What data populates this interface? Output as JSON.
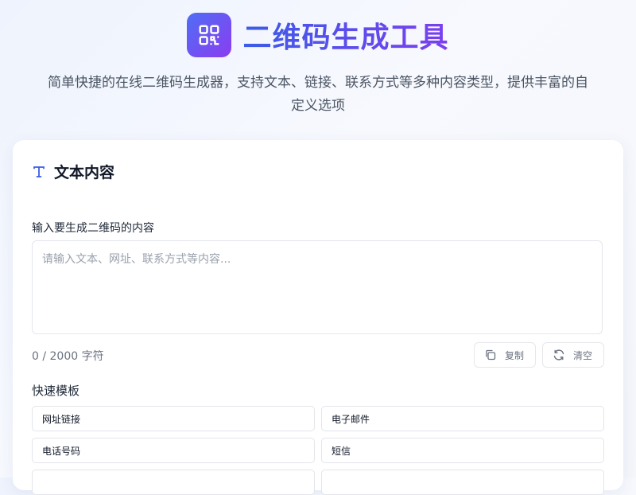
{
  "app": {
    "title": "二维码生成工具",
    "subtitle": "简单快捷的在线二维码生成器，支持文本、链接、联系方式等多种内容类型，提供丰富的自定义选项",
    "logo_icon": "qr-code-icon"
  },
  "card": {
    "title": "文本内容",
    "title_icon": "text-type-icon",
    "input_label": "输入要生成二维码的内容",
    "input_value": "",
    "input_placeholder": "请输入文本、网址、联系方式等内容...",
    "char_count": "0 / 2000 字符",
    "copy_label": "复制",
    "copy_icon": "copy-icon",
    "clear_label": "清空",
    "clear_icon": "refresh-icon"
  },
  "templates": {
    "label": "快速模板",
    "items": [
      {
        "label": "网址链接"
      },
      {
        "label": "电子邮件"
      },
      {
        "label": "电话号码"
      },
      {
        "label": "短信"
      },
      {
        "label": ""
      },
      {
        "label": ""
      }
    ]
  },
  "colors": {
    "accent_start": "#4f6ef5",
    "accent_end": "#8b3cf0",
    "title_icon": "#3b5ce6"
  }
}
